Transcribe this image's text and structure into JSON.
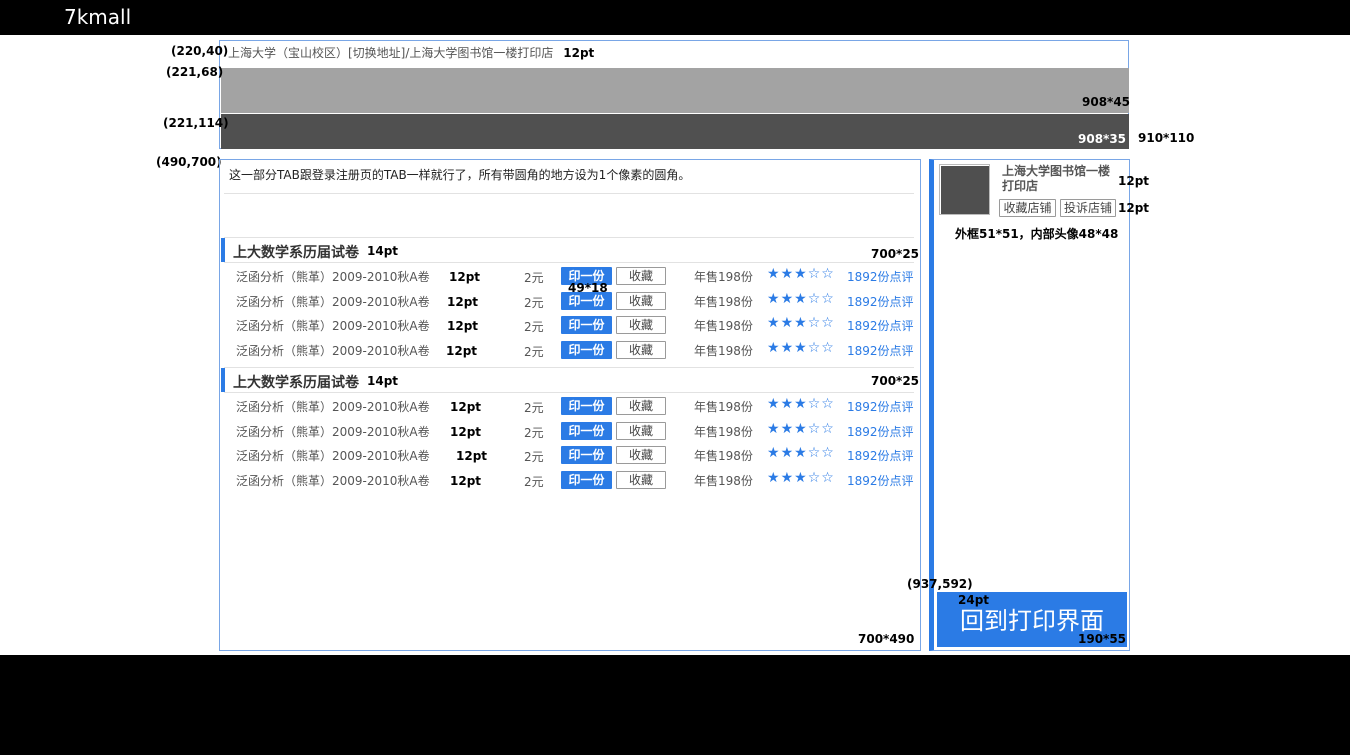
{
  "app": {
    "brand": "7kmall"
  },
  "header": {
    "address": "上海大学（宝山校区）[切换地址]/上海大学图书馆一楼打印店"
  },
  "tabs_note": "这一部分TAB跟登录注册页的TAB一样就行了，所有带圆角的地方设为1个像素的圆角。",
  "sections": [
    {
      "title": "上大数学系历届试卷",
      "rows": [
        {
          "name": "泛函分析（熊革）2009-2010秋A卷",
          "price": "2元",
          "print": "印一份",
          "fav": "收藏",
          "sales": "年售198份",
          "stars": 3,
          "reviews": "1892份点评"
        },
        {
          "name": "泛函分析（熊革）2009-2010秋A卷",
          "price": "2元",
          "print": "印一份",
          "fav": "收藏",
          "sales": "年售198份",
          "stars": 3,
          "reviews": "1892份点评"
        },
        {
          "name": "泛函分析（熊革）2009-2010秋A卷",
          "price": "2元",
          "print": "印一份",
          "fav": "收藏",
          "sales": "年售198份",
          "stars": 3,
          "reviews": "1892份点评"
        },
        {
          "name": "泛函分析（熊革）2009-2010秋A卷",
          "price": "2元",
          "print": "印一份",
          "fav": "收藏",
          "sales": "年售198份",
          "stars": 3,
          "reviews": "1892份点评"
        }
      ]
    },
    {
      "title": "上大数学系历届试卷",
      "rows": [
        {
          "name": "泛函分析（熊革）2009-2010秋A卷",
          "price": "2元",
          "print": "印一份",
          "fav": "收藏",
          "sales": "年售198份",
          "stars": 3,
          "reviews": "1892份点评"
        },
        {
          "name": "泛函分析（熊革）2009-2010秋A卷",
          "price": "2元",
          "print": "印一份",
          "fav": "收藏",
          "sales": "年售198份",
          "stars": 3,
          "reviews": "1892份点评"
        },
        {
          "name": "泛函分析（熊革）2009-2010秋A卷",
          "price": "2元",
          "print": "印一份",
          "fav": "收藏",
          "sales": "年售198份",
          "stars": 3,
          "reviews": "1892份点评"
        },
        {
          "name": "泛函分析（熊革）2009-2010秋A卷",
          "price": "2元",
          "print": "印一份",
          "fav": "收藏",
          "sales": "年售198份",
          "stars": 3,
          "reviews": "1892份点评"
        }
      ]
    }
  ],
  "sidebar": {
    "shop_name": "上海大学图书馆一楼打印店",
    "fav_shop": "收藏店铺",
    "complain_shop": "投诉店铺",
    "back_button": "回到打印界面"
  },
  "annotations": {
    "a_220_40": "(220,40)",
    "a_221_68": "(221,68)",
    "a_221_114": "(221,114)",
    "a_490_700": "(490,700)",
    "a_937_592": "(937,592)",
    "pt12": "12pt",
    "pt14": "14pt",
    "pt24": "24pt",
    "s908_45": "908*45",
    "s908_35": "908*35",
    "s910_110": "910*110",
    "s700_25": "700*25",
    "s49_18": "49*18",
    "s700_490": "700*490",
    "s190_55": "190*55",
    "avatar_note": "外框51*51，内部头像48*48"
  },
  "colors": {
    "accent": "#2b7be5",
    "frame": "#79a6e6",
    "band_light": "#a3a3a3",
    "band_dark": "#505050"
  }
}
